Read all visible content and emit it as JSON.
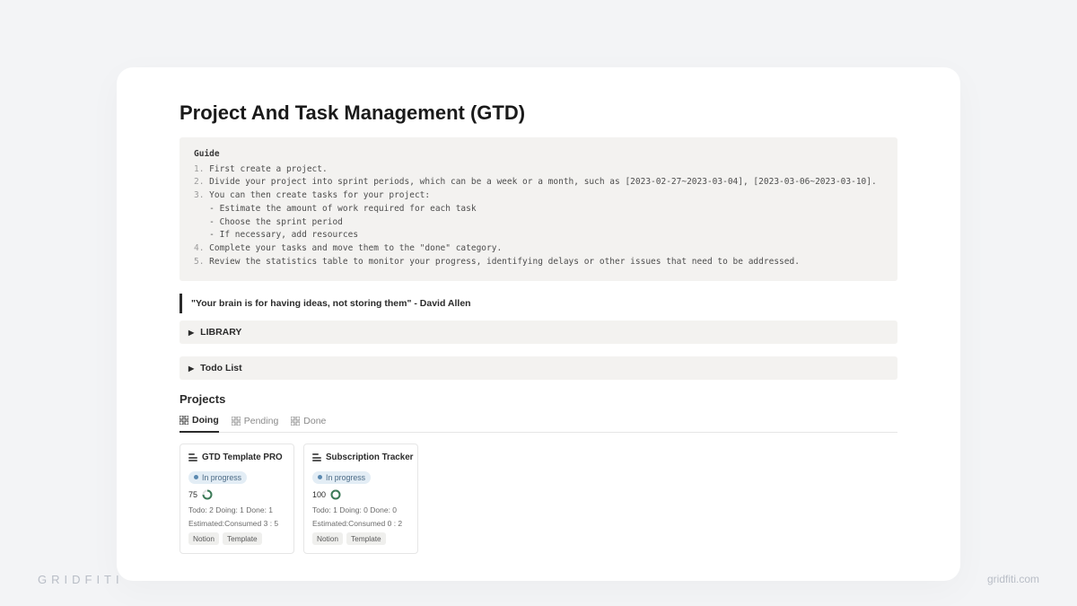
{
  "title": "Project And Task Management (GTD)",
  "guide": {
    "heading": "Guide",
    "lines": [
      "First create a project.",
      "Divide your project into sprint periods, which can be a week or a month, such as [2023-02-27~2023-03-04], [2023-03-06~2023-03-10].",
      "You can then create tasks for your project:",
      "Complete your tasks and move them to the \"done\" category.",
      "Review the statistics table to monitor your progress, identifying delays or other issues that need to be addressed."
    ],
    "sublines": [
      "- Estimate the amount of work required for each task",
      "- Choose the sprint period",
      "- If necessary, add resources"
    ]
  },
  "quote": "\"Your brain is for having ideas, not storing them\" - David Allen",
  "toggles": {
    "library": "LIBRARY",
    "todo": "Todo List"
  },
  "projects_heading": "Projects",
  "tabs": [
    "Doing",
    "Pending",
    "Done"
  ],
  "cards": [
    {
      "title": "GTD Template PRO",
      "status": "In progress",
      "progress": "75",
      "meta1": "Todo: 2  Doing: 1 Done: 1",
      "meta2": "Estimated:Consumed 3 : 5",
      "tags": [
        "Notion",
        "Template"
      ]
    },
    {
      "title": "Subscription Tracker",
      "status": "In progress",
      "progress": "100",
      "meta1": "Todo: 1  Doing: 0 Done: 0",
      "meta2": "Estimated:Consumed 0 : 2",
      "tags": [
        "Notion",
        "Template"
      ]
    }
  ],
  "footer": {
    "left": "GRIDFITI",
    "right": "gridfiti.com"
  }
}
